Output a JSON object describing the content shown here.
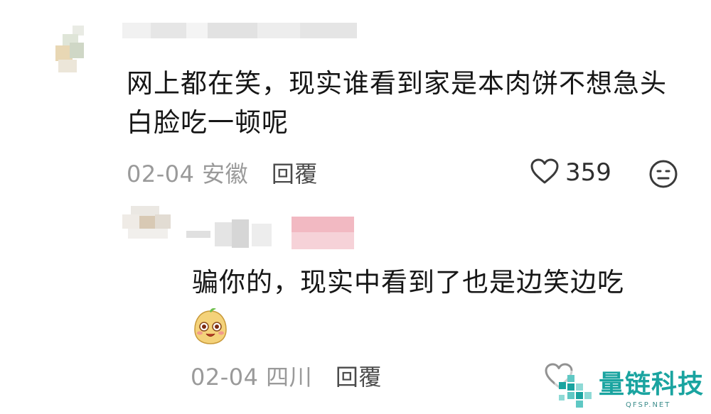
{
  "comment": {
    "text": "网上都在笑，现实谁看到家是本肉饼不想急头白脸吃一顿呢",
    "date": "02-04",
    "location": "安徽",
    "reply_label": "回覆",
    "like_count": "359",
    "like_icon": "heart-outline-icon",
    "dislike_icon": "dislike-face-icon"
  },
  "reply": {
    "text": "骗你的，现实中看到了也是边笑边吃",
    "emoji": "potato-face-emoji",
    "date": "02-04",
    "location": "四川",
    "reply_label": "回覆",
    "like_icon": "heart-outline-icon"
  },
  "watermark": {
    "text": "量链科技",
    "sub": "QFSP.NET",
    "accent": "#1aa4a0"
  }
}
